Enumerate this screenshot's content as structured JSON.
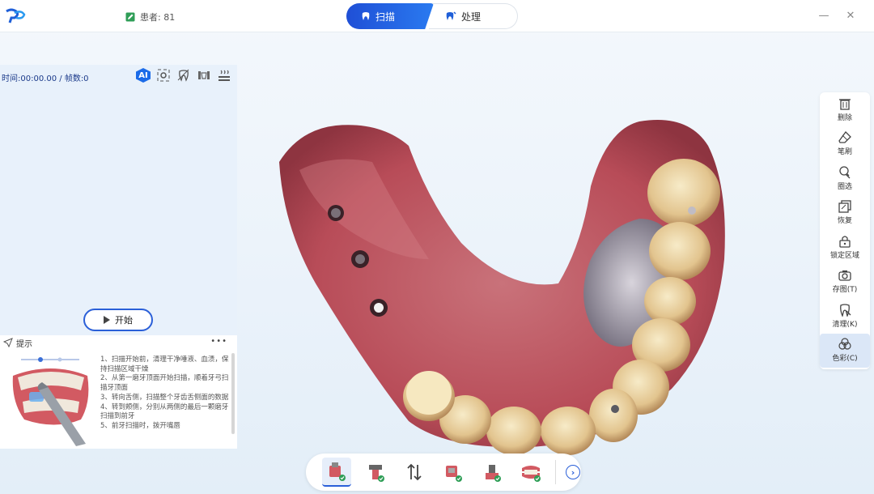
{
  "header": {
    "patient_label": "患者: 81",
    "tabs": [
      {
        "label": "扫描",
        "active": true
      },
      {
        "label": "处理",
        "active": false
      }
    ],
    "minimize_label": "—",
    "close_label": "✕"
  },
  "scan_panel": {
    "timer_text": "时间:00:00.00 / 帧数:0",
    "ai_label": "AI",
    "start_label": "开始"
  },
  "tips": {
    "title": "提示",
    "more_label": "•••",
    "lines": [
      "1、扫描开始前，清理干净唾液、血渍，保持扫描区域干燥",
      "2、从第一磨牙顶面开始扫描，顺着牙弓扫描牙顶面",
      "3、转向舌侧，扫描整个牙齿舌侧面的数据",
      "4、转到颊侧，分别从两侧的最后一颗磨牙扫描到前牙",
      "5、前牙扫描时，拨开嘴唇"
    ]
  },
  "right_tools": [
    {
      "label": "删除",
      "icon": "trash-icon"
    },
    {
      "label": "笔刷",
      "icon": "eraser-icon"
    },
    {
      "label": "圈选",
      "icon": "lasso-icon"
    },
    {
      "label": "恢复",
      "icon": "restore-icon"
    },
    {
      "label": "锁定区域",
      "icon": "lock-icon"
    },
    {
      "label": "存图(T)",
      "icon": "camera-icon"
    },
    {
      "label": "清理(K)",
      "icon": "tooth-clean-icon"
    },
    {
      "label": "色彩(C)",
      "icon": "color-icon",
      "active": true
    }
  ],
  "colors": {
    "accent": "#2a5fd8",
    "gum": "#c8555e",
    "tooth": "#e9d3a6"
  }
}
